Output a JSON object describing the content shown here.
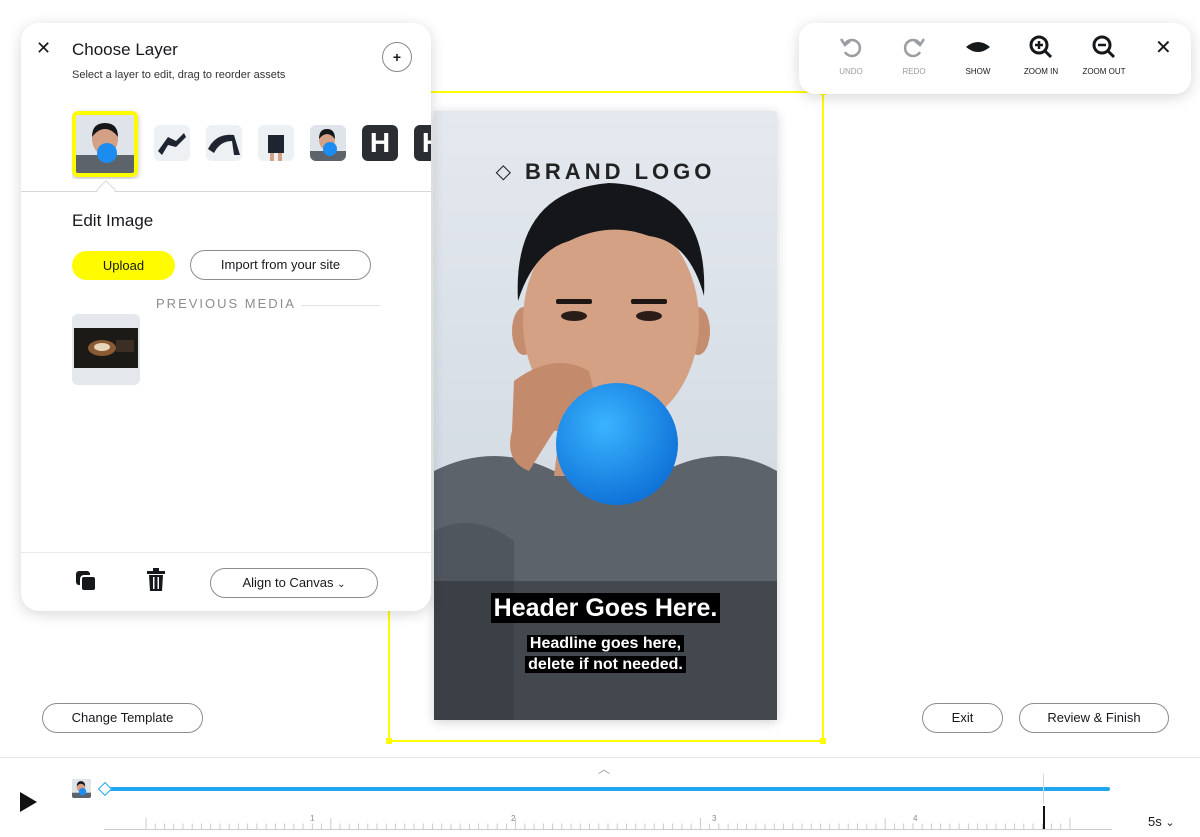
{
  "panel": {
    "title": "Choose Layer",
    "subtitle": "Select a layer to edit, drag to reorder assets",
    "add_icon": "plus",
    "close_icon": "close",
    "layers": [
      {
        "name": "layer-photo-balloon",
        "selected": true
      },
      {
        "name": "layer-runner"
      },
      {
        "name": "layer-stretch"
      },
      {
        "name": "layer-shorts"
      },
      {
        "name": "layer-photo-balloon-2"
      },
      {
        "name": "layer-text",
        "glyph": "H"
      },
      {
        "name": "layer-text-2",
        "glyph": "H"
      }
    ],
    "edit_title": "Edit Image",
    "upload_label": "Upload",
    "import_label": "Import from your site",
    "previous_media_label": "PREVIOUS MEDIA",
    "align_label": "Align to Canvas"
  },
  "toolbar": {
    "undo": "UNDO",
    "redo": "REDO",
    "show": "SHOW",
    "zoom_in": "ZOOM IN",
    "zoom_out": "ZOOM OUT"
  },
  "canvas": {
    "brand_logo": "BRAND LOGO",
    "header": "Header Goes Here.",
    "headline_line1": "Headline goes here,",
    "headline_line2": "delete if not needed."
  },
  "actions": {
    "change_template": "Change Template",
    "exit": "Exit",
    "review_finish": "Review & Finish"
  },
  "timeline": {
    "ticks": [
      "1",
      "2",
      "3",
      "4"
    ],
    "duration": "5s",
    "progress": 0.93,
    "track_color": "#21a6f0"
  },
  "colors": {
    "accent": "#fffc00",
    "text": "#16191c"
  }
}
